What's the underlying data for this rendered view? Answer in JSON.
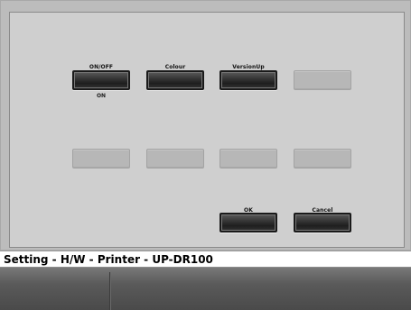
{
  "buttons_row1": [
    {
      "label": "ON/OFF",
      "sub": "ON",
      "active": true
    },
    {
      "label": "Colour",
      "sub": "",
      "active": true
    },
    {
      "label": "VersionUp",
      "sub": "",
      "active": true
    },
    {
      "label": "",
      "sub": "",
      "active": false
    }
  ],
  "buttons_row2": [
    {
      "label": "",
      "active": false
    },
    {
      "label": "",
      "active": false
    },
    {
      "label": "",
      "active": false
    },
    {
      "label": "",
      "active": false
    }
  ],
  "dialog_actions": {
    "ok_label": "OK",
    "cancel_label": "Cancel"
  },
  "status": {
    "breadcrumb": "Setting - H/W - Printer - UP-DR100"
  }
}
